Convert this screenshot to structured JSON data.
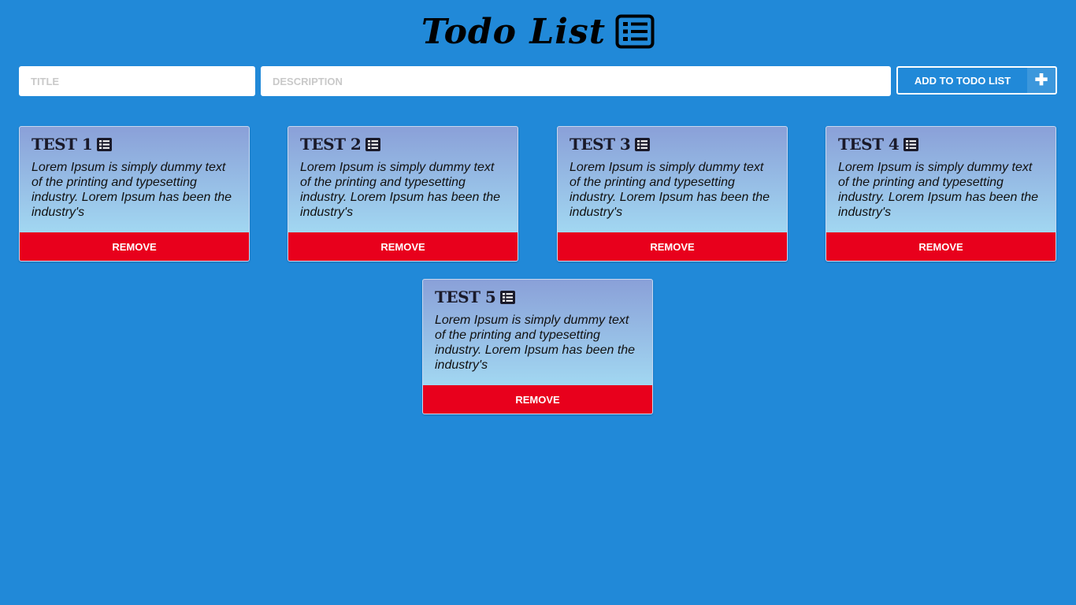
{
  "header": {
    "title": "Todo List",
    "icon": "list-alt-icon"
  },
  "form": {
    "title_placeholder": "TITLE",
    "description_placeholder": "DESCRIPTION",
    "add_label": "ADD TO TODO LIST",
    "add_icon": "plus-icon"
  },
  "todos": [
    {
      "title": "TEST 1",
      "description": "Lorem Ipsum is simply dummy text of the printing and typesetting industry. Lorem Ipsum has been the industry's",
      "remove_label": "REMOVE"
    },
    {
      "title": "TEST 2",
      "description": "Lorem Ipsum is simply dummy text of the printing and typesetting industry. Lorem Ipsum has been the industry's",
      "remove_label": "REMOVE"
    },
    {
      "title": "TEST 3",
      "description": "Lorem Ipsum is simply dummy text of the printing and typesetting industry. Lorem Ipsum has been the industry's",
      "remove_label": "REMOVE"
    },
    {
      "title": "TEST 4",
      "description": "Lorem Ipsum is simply dummy text of the printing and typesetting industry. Lorem Ipsum has been the industry's",
      "remove_label": "REMOVE"
    },
    {
      "title": "TEST 5",
      "description": "Lorem Ipsum is simply dummy text of the printing and typesetting industry. Lorem Ipsum has been the industry's",
      "remove_label": "REMOVE"
    }
  ],
  "colors": {
    "background": "#2189d8",
    "remove": "#e8001c",
    "card_top": "#8aa0d8",
    "card_bottom": "#a8e6f8"
  }
}
